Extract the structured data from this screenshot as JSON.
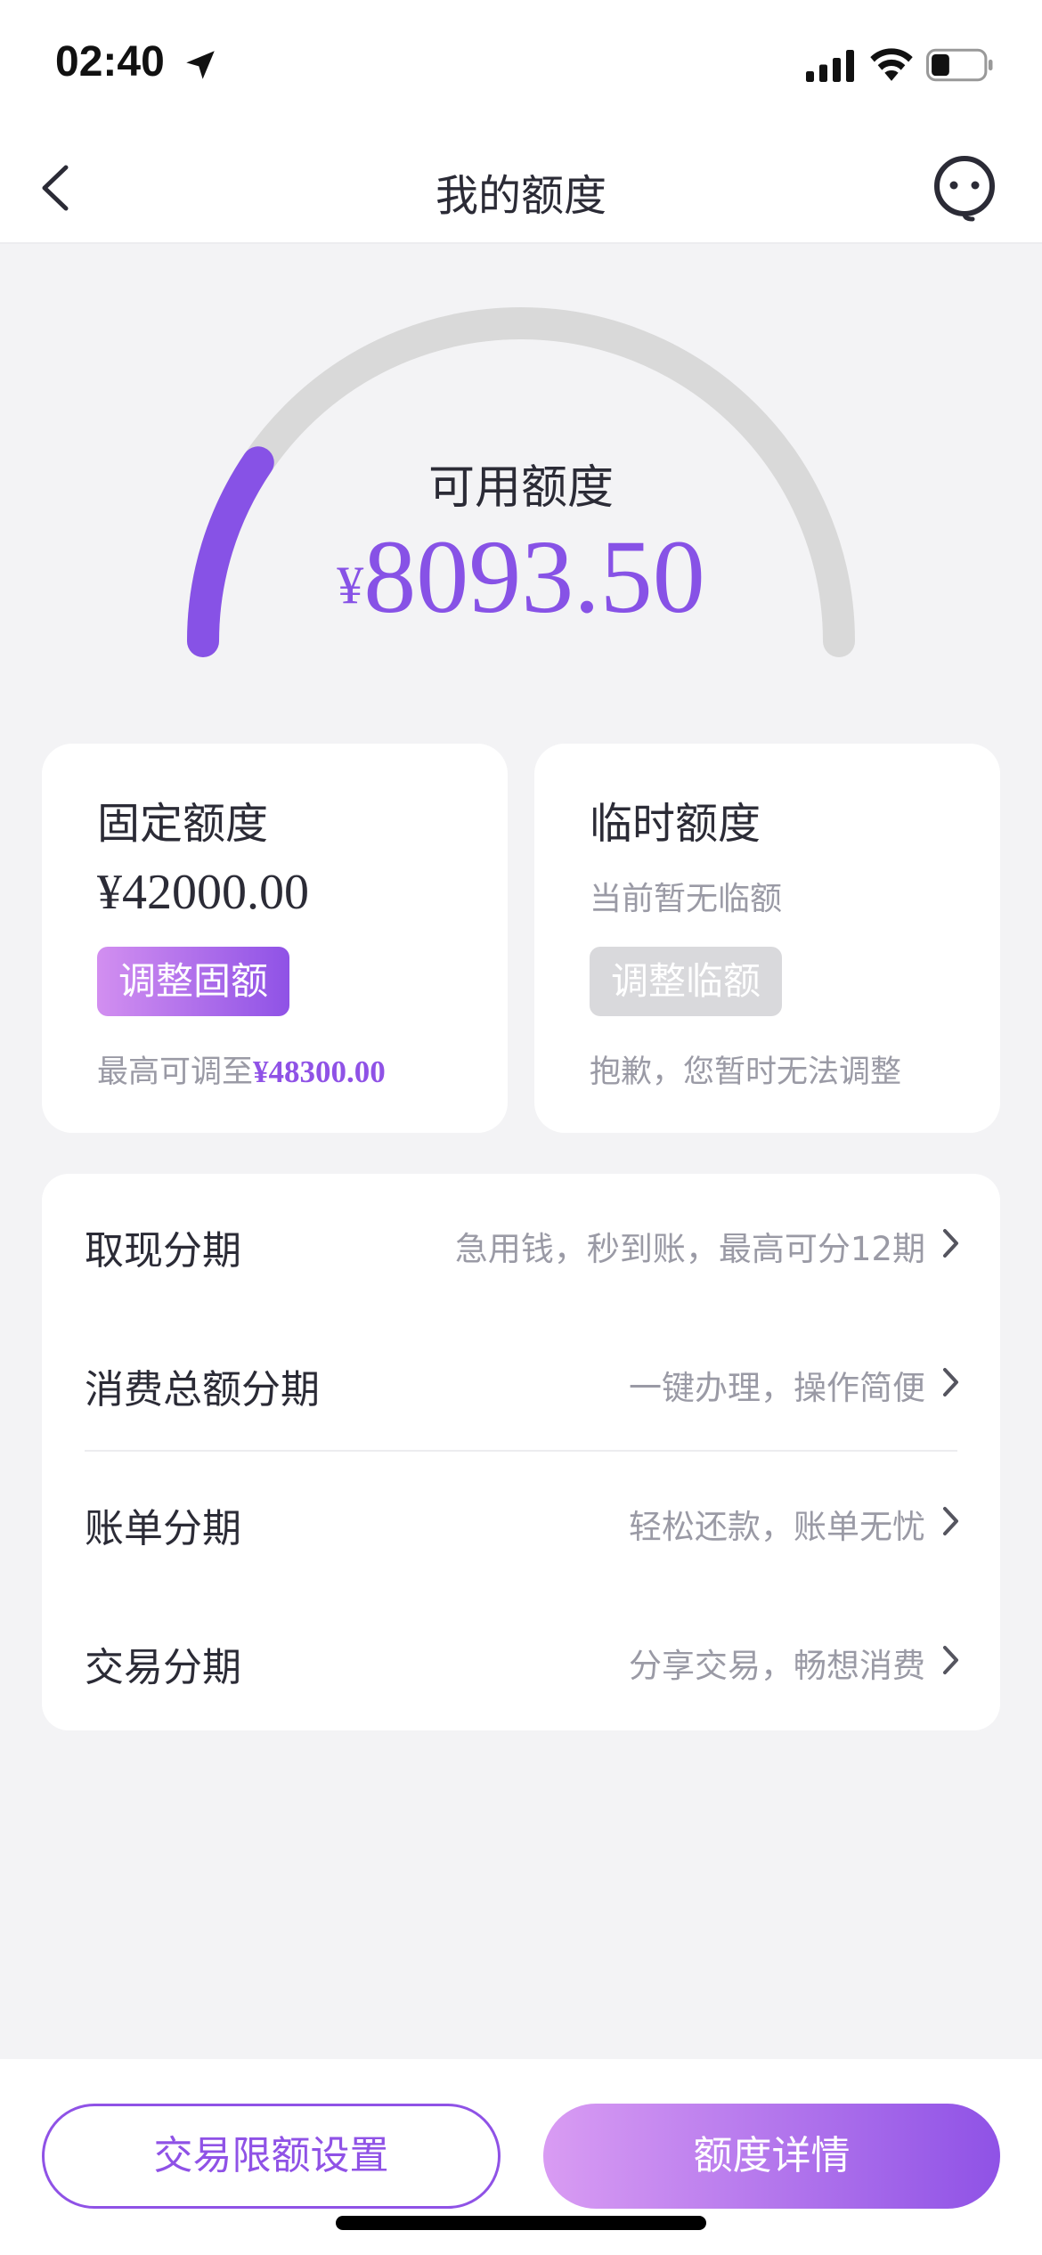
{
  "status_bar": {
    "time": "02:40",
    "icons": [
      "location-arrow-icon",
      "cellular-signal-icon",
      "wifi-icon",
      "battery-icon"
    ]
  },
  "nav": {
    "title": "我的额度",
    "back_icon": "chevron-left-icon",
    "service_icon": "customer-service-icon"
  },
  "gauge": {
    "label": "可用额度",
    "currency": "¥",
    "amount": "8093.50",
    "fill_fraction": 0.19,
    "track_color": "#d9d9d9",
    "fill_color": "#8752e6"
  },
  "cards": {
    "fixed": {
      "title": "固定额度",
      "amount": "¥42000.00",
      "button": "调整固额",
      "note_prefix": "最高可调至",
      "note_value": "¥48300.00"
    },
    "temp": {
      "title": "临时额度",
      "status": "当前暂无临额",
      "button": "调整临额",
      "note": "抱歉，您暂时无法调整"
    }
  },
  "installments": [
    {
      "title": "取现分期",
      "desc": "急用钱，秒到账，最高可分12期"
    },
    {
      "title": "消费总额分期",
      "desc": "一键办理，操作简便"
    },
    {
      "title": "账单分期",
      "desc": "轻松还款，账单无忧"
    },
    {
      "title": "交易分期",
      "desc": "分享交易，畅想消费"
    }
  ],
  "bottom": {
    "limit_settings": "交易限额设置",
    "limit_details": "额度详情"
  },
  "colors": {
    "accent": "#8f52e6",
    "background": "#f3f3f5"
  }
}
